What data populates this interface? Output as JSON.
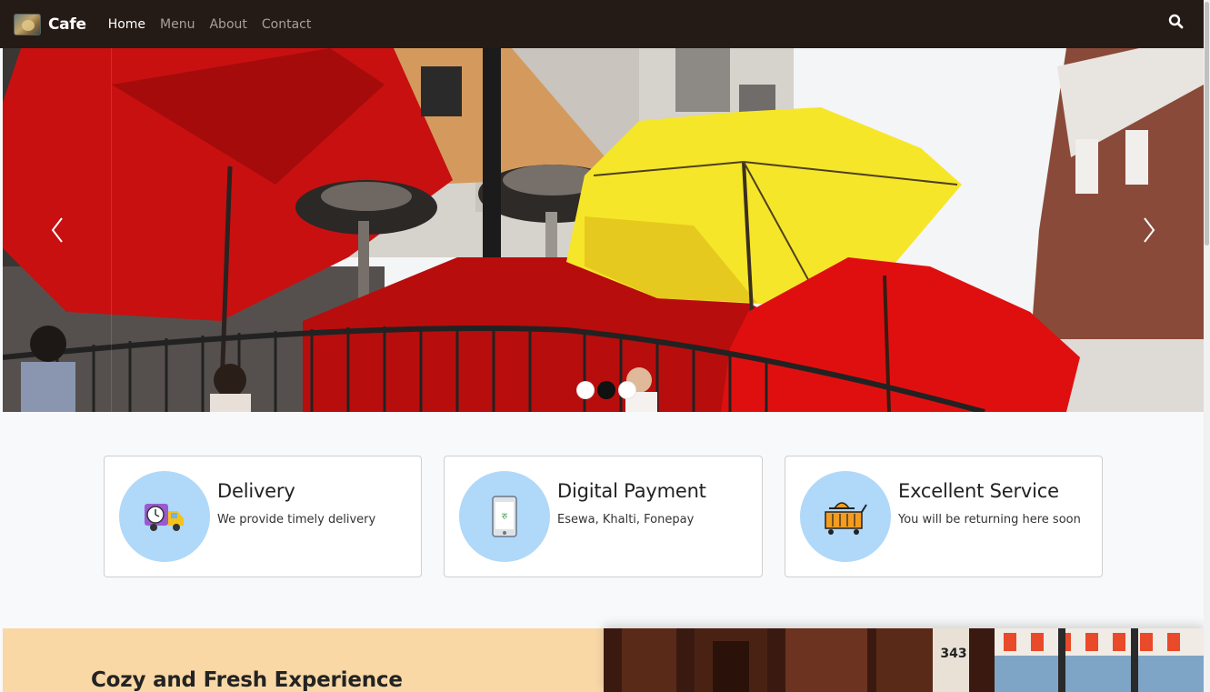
{
  "navbar": {
    "brand": "Cafe",
    "links": [
      {
        "label": "Home",
        "active": true
      },
      {
        "label": "Menu",
        "active": false
      },
      {
        "label": "About",
        "active": false
      },
      {
        "label": "Contact",
        "active": false
      }
    ],
    "search_icon": "search-icon",
    "background_color": "#241a16"
  },
  "carousel": {
    "active_index": 1,
    "slide_count": 3,
    "prev_icon": "chevron-left-icon",
    "next_icon": "chevron-right-icon"
  },
  "features": [
    {
      "title": "Delivery",
      "text": "We provide timely delivery",
      "icon": "delivery-truck-icon"
    },
    {
      "title": "Digital Payment",
      "text": "Esewa, Khalti, Fonepay",
      "icon": "mobile-payment-icon"
    },
    {
      "title": "Excellent Service",
      "text": "You will be returning here soon",
      "icon": "service-cart-icon"
    }
  ],
  "feature_circle_color": "#b0d8f9",
  "experience": {
    "title": "Cozy and Fresh Experience",
    "background_color": "#f9d8a6"
  }
}
